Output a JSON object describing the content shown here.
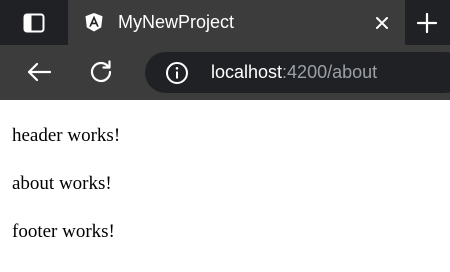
{
  "tab": {
    "title": "MyNewProject",
    "favicon": "angular-logo-icon"
  },
  "address_bar": {
    "host": "localhost",
    "path": ":4200/about",
    "info_icon": "info-icon"
  },
  "page": {
    "paragraphs": [
      "header works!",
      "about works!",
      "footer works!"
    ]
  },
  "colors": {
    "tabstrip": "#202124",
    "active_tab": "#3c3c3c",
    "toolbar": "#3c3c3c",
    "omnibox": "#202124",
    "url_muted": "#9aa0a6"
  }
}
